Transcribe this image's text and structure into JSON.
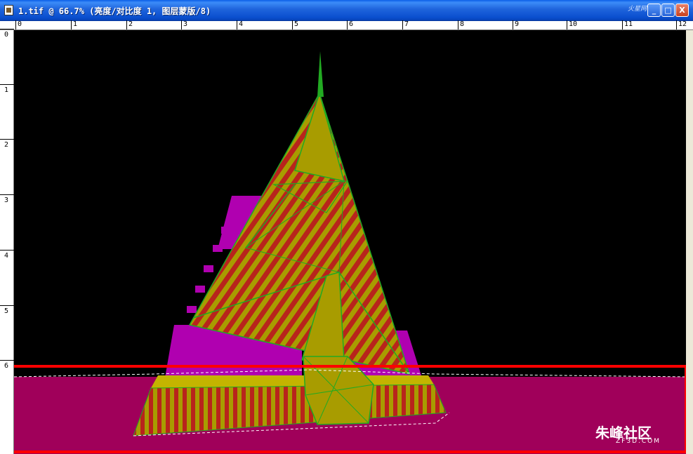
{
  "window": {
    "title": "1.tif @ 66.7% (亮度/对比度 1, 图层蒙版/8)",
    "top_watermark": "火星网",
    "buttons": {
      "minimize": "_",
      "maximize": "□",
      "close": "X"
    }
  },
  "ruler": {
    "horizontal": [
      "0",
      "1",
      "2",
      "3",
      "4",
      "5",
      "6",
      "7",
      "8",
      "9",
      "10",
      "11",
      "12"
    ],
    "vertical": [
      "0",
      "1",
      "2",
      "3",
      "4",
      "5",
      "6"
    ]
  },
  "watermark": {
    "brand": "朱峰社区",
    "site": "ZF3D.COM"
  },
  "colors": {
    "background": "#000000",
    "magenta": "#a0005a",
    "highlight": "#ff0000"
  }
}
